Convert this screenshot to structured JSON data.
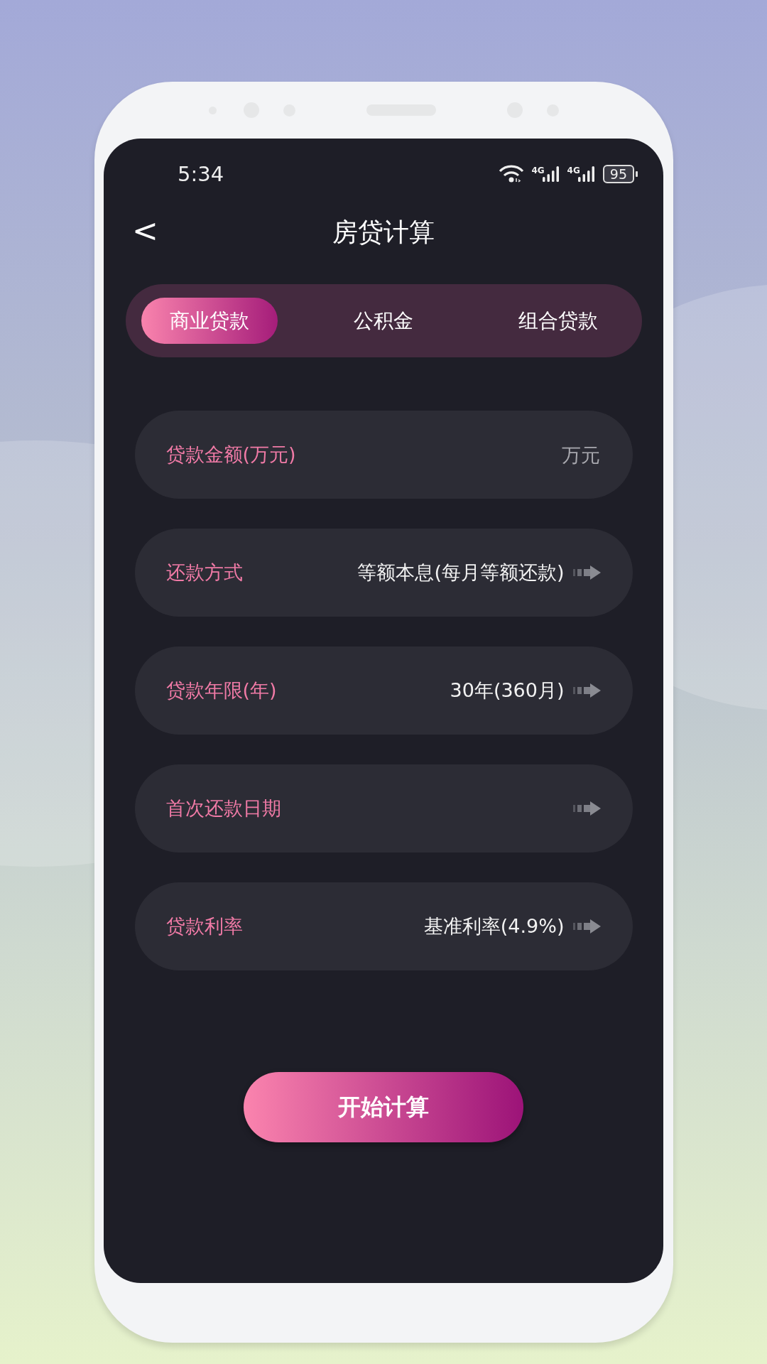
{
  "status_bar": {
    "time": "5:34",
    "signal_labels": [
      "4G",
      "4G"
    ],
    "battery": "95"
  },
  "header": {
    "back": "<",
    "title": "房贷计算"
  },
  "tabs": [
    {
      "label": "商业贷款",
      "selected": true
    },
    {
      "label": "公积金",
      "selected": false
    },
    {
      "label": "组合贷款",
      "selected": false
    }
  ],
  "form_rows": [
    {
      "kind": "input",
      "label": "贷款金额(万元)",
      "placeholder": "万元"
    },
    {
      "kind": "select",
      "label": "还款方式",
      "value": "等额本息(每月等额还款)"
    },
    {
      "kind": "select",
      "label": "贷款年限(年)",
      "value": "30年(360月)"
    },
    {
      "kind": "select",
      "label": "首次还款日期"
    },
    {
      "kind": "select",
      "label": "贷款利率",
      "value": "基准利率(4.9%)"
    }
  ],
  "button": "开始计算"
}
